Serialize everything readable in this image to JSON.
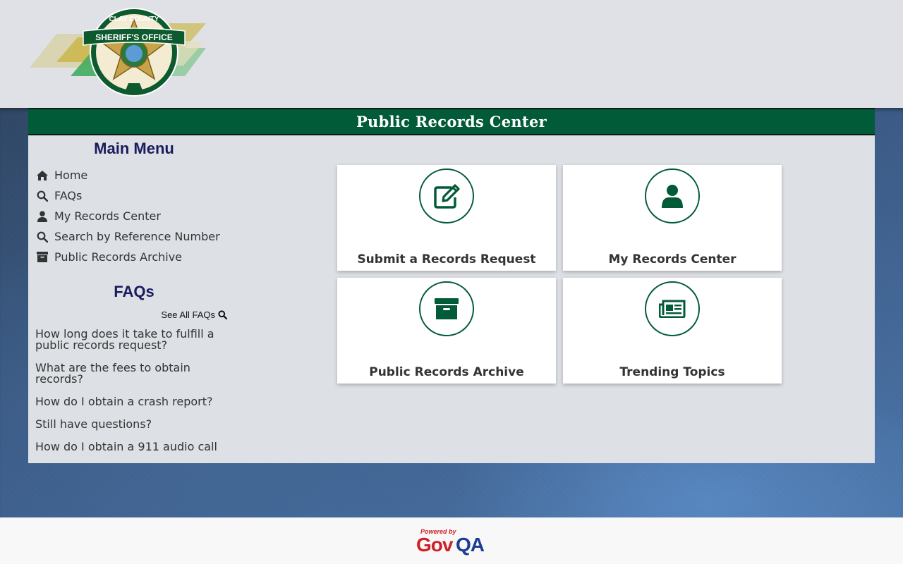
{
  "header": {
    "logo": {
      "top_text": "CLAY COUNTY",
      "banner_text": "SHERIFF'S OFFICE",
      "icon": "sheriff-star-badge-icon"
    }
  },
  "page_title": "Public Records Center",
  "sidebar": {
    "main_menu_title": "Main Menu",
    "menu": [
      {
        "label": "Home",
        "icon": "home-icon"
      },
      {
        "label": "FAQs",
        "icon": "search-icon"
      },
      {
        "label": "My Records Center",
        "icon": "user-icon"
      },
      {
        "label": "Search by Reference Number",
        "icon": "search-icon"
      },
      {
        "label": "Public Records Archive",
        "icon": "archive-icon"
      }
    ],
    "faqs_title": "FAQs",
    "see_all_label": "See All FAQs",
    "faqs": [
      "How long does it take to fulfill a public records request?",
      "What are the fees to obtain records?",
      "How do I obtain a crash report?",
      "Still have questions?",
      "How do I obtain a 911 audio call"
    ]
  },
  "cards": [
    {
      "label": "Submit a Records Request",
      "icon": "edit-icon"
    },
    {
      "label": "My Records Center",
      "icon": "user-icon"
    },
    {
      "label": "Public Records Archive",
      "icon": "archive-icon"
    },
    {
      "label": "Trending Topics",
      "icon": "newspaper-icon"
    }
  ],
  "footer": {
    "powered_by": "Powered by",
    "brand_gov": "Gov",
    "brand_qa": "QA"
  },
  "colors": {
    "primary_green": "#025b38",
    "heading_navy": "#1a1c5c",
    "brand_red": "#d02027",
    "brand_blue": "#1b3d93"
  }
}
